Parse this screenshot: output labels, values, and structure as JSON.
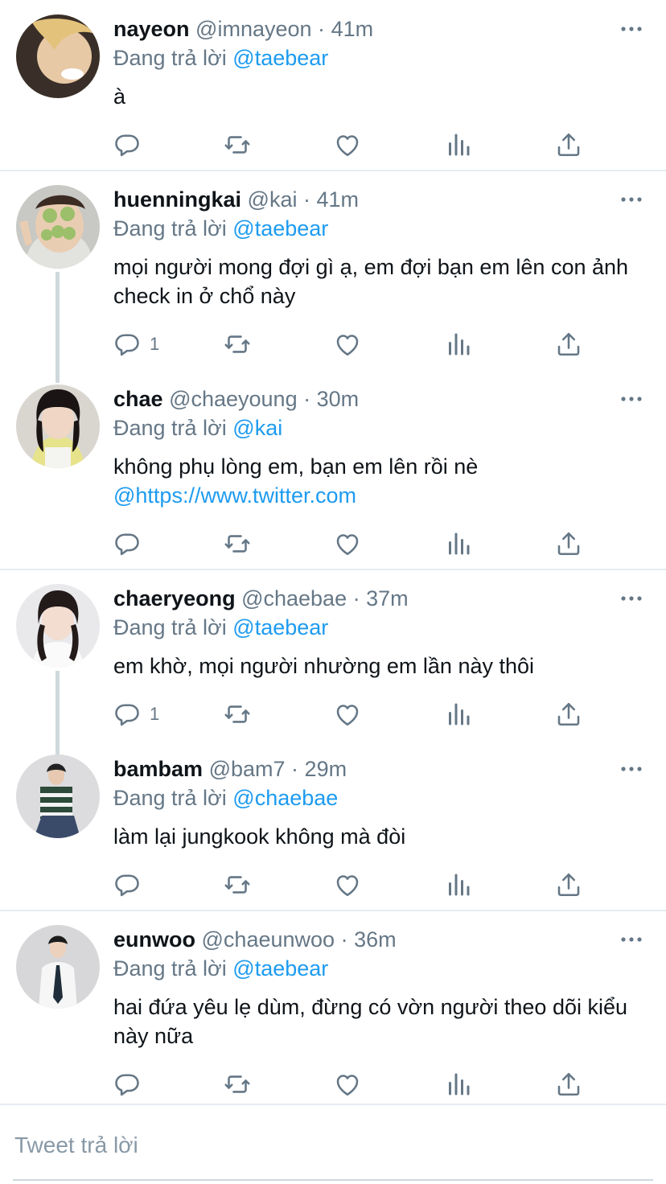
{
  "reply_prefix": "Đang trả lời",
  "composer": {
    "placeholder": "Tweet trả lời"
  },
  "colors": {
    "accent": "#1d9bf0",
    "secondary": "#657786",
    "divider": "#e6ecf0"
  },
  "tweets": [
    {
      "name": "nayeon",
      "handle": "@imnayeon",
      "dot": "·",
      "time": "41m",
      "reply_to": "@taebear",
      "text": "à",
      "reply_count": ""
    },
    {
      "name": "huenningkai",
      "handle": "@kai",
      "dot": "·",
      "time": "41m",
      "reply_to": "@taebear",
      "text": "mọi người mong đợi gì ạ, em đợi bạn em lên con ảnh check in ở chổ này",
      "reply_count": "1"
    },
    {
      "name": "chae",
      "handle": "@chaeyoung",
      "dot": "·",
      "time": "30m",
      "reply_to": "@kai",
      "text": "không phụ lòng em, bạn em lên rồi nè",
      "link": "@https://www.twitter.com",
      "reply_count": ""
    },
    {
      "name": "chaeryeong",
      "handle": "@chaebae",
      "dot": "·",
      "time": "37m",
      "reply_to": "@taebear",
      "text": "em khờ, mọi người nhường em lần này thôi",
      "reply_count": "1"
    },
    {
      "name": "bambam",
      "handle": "@bam7",
      "dot": "·",
      "time": "29m",
      "reply_to": "@chaebae",
      "text": "làm lại jungkook không mà đòi",
      "reply_count": ""
    },
    {
      "name": "eunwoo",
      "handle": "@chaeunwoo",
      "dot": "·",
      "time": "36m",
      "reply_to": "@taebear",
      "text": "hai đứa yêu lẹ dùm, đừng có vờn người theo dõi kiểu này nữa",
      "reply_count": ""
    }
  ]
}
